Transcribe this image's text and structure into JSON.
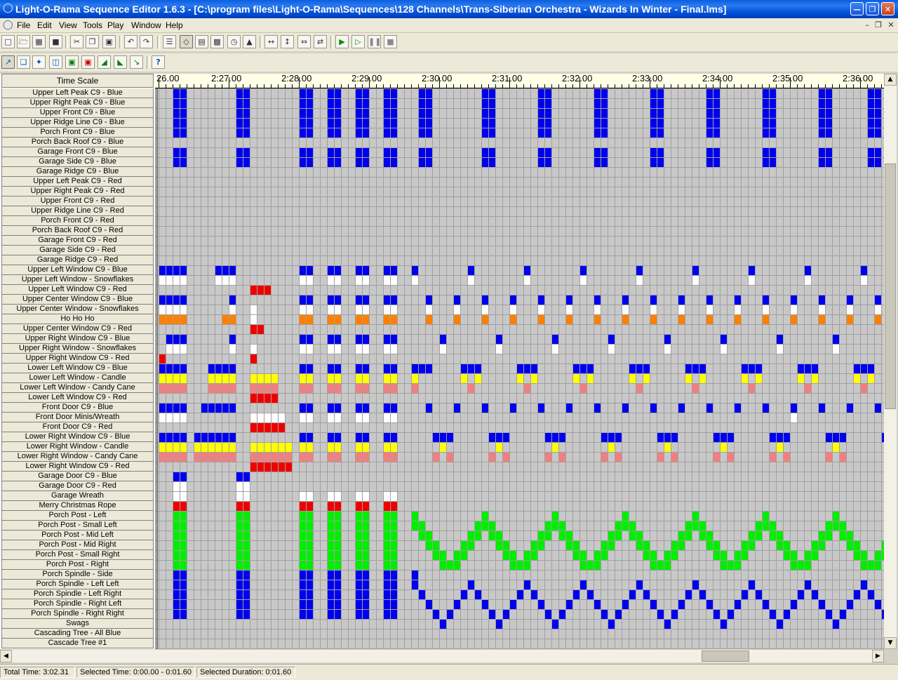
{
  "window": {
    "title": "Light-O-Rama Sequence Editor 1.6.3 - [C:\\program files\\Light-O-Rama\\Sequences\\128 Channels\\Trans-Siberian Orchestra - Wizards In Winter - Final.lms]",
    "minimize_icon": "minimize-icon",
    "restore_icon": "restore-icon",
    "close_icon": "close-icon"
  },
  "menu": {
    "items": [
      "File",
      "Edit",
      "View",
      "Tools",
      "Play",
      "Window",
      "Help"
    ]
  },
  "toolbar1": [
    "new",
    "open",
    "save",
    "disabled",
    "cut",
    "copy",
    "paste",
    "undo",
    "redo",
    "film",
    "select",
    "grid",
    "color",
    "clock",
    "tree",
    "zoom-in",
    "zoom-fit",
    "zoom-center",
    "zoom-out",
    "play",
    "play-from",
    "pause",
    "stop"
  ],
  "toolbar2": [
    "pointer",
    "copy-tool",
    "sparkle",
    "intensity",
    "on",
    "off",
    "ramp-up",
    "ramp-down",
    "fade",
    "help"
  ],
  "timescale_label": "Time Scale",
  "ruler_labels": [
    "26.00",
    "2:27.00",
    "2:28.00",
    "2:29.00",
    "2:30.00",
    "2:31.00",
    "2:32.00",
    "2:33.00",
    "2:34.00",
    "2:35.00",
    "2:36.00"
  ],
  "channels": [
    "Upper Left Peak C9 - Blue",
    "Upper Right Peak C9 - Blue",
    "Upper Front C9 - Blue",
    "Upper Ridge Line C9 - Blue",
    "Porch Front C9 - Blue",
    "Porch Back Roof C9 - Blue",
    "Garage Front C9 - Blue",
    "Garage Side C9 - Blue",
    "Garage Ridge C9 - Blue",
    "Upper Left Peak C9 - Red",
    "Upper Right Peak C9 - Red",
    "Upper Front C9 - Red",
    "Upper Ridge Line C9 - Red",
    "Porch Front C9 - Red",
    "Porch Back Roof C9 - Red",
    "Garage Front C9 - Red",
    "Garage Side C9 - Red",
    "Garage Ridge C9 - Red",
    "Upper Left Window C9 - Blue",
    "Upper Left Window - Snowflakes",
    "Upper Left Window C9 - Red",
    "Upper Center Window C9 - Blue",
    "Upper Center Window - Snowflakes",
    "Ho Ho Ho",
    "Upper Center Window C9 - Red",
    "Upper Right Window C9 - Blue",
    "Upper Right Window - Snowflakes",
    "Upper Right Window C9 - Red",
    "Lower Left Window C9 - Blue",
    "Lower Left Window - Candle",
    "Lower Left Window - Candy Cane",
    "Lower Left Window C9 - Red",
    "Front Door C9 - Blue",
    "Front Door Minis/Wreath",
    "Front Door C9 - Red",
    "Lower Right Window C9 - Blue",
    "Lower Right Window - Candle",
    "Lower Right Window - Candy Cane",
    "Lower Right Window C9 - Red",
    "Garage Door C9 - Blue",
    "Garage Door C9 - Red",
    "Garage Wreath",
    "Merry Christmas Rope",
    "Porch Post - Left",
    "Porch Post - Small Left",
    "Porch Post - Mid Left",
    "Porch Post - Mid Right",
    "Porch Post - Small Right",
    "Porch Post - Right",
    "Porch Spindle - Side",
    "Porch Spindle - Left Left",
    "Porch Spindle - Left Right",
    "Porch Spindle - Right Left",
    "Porch Spindle - Right Right",
    "Swags",
    "Cascading Tree - All Blue",
    "Cascade Tree #1"
  ],
  "colors": {
    "blue": "#0000ee",
    "red": "#ee0000",
    "white": "#ffffff",
    "orange": "#ff8000",
    "yellow": "#ffff00",
    "pink": "#f08080",
    "green": "#00ee00",
    "grid_bg": "#c8c8c8",
    "grid_line": "#a0a0a0"
  },
  "status": {
    "total_time": "Total Time: 3:02.31",
    "selected_time": "Selected Time: 0:00.00 - 0:01.60",
    "selected_duration": "Selected Duration: 0:01.60"
  }
}
